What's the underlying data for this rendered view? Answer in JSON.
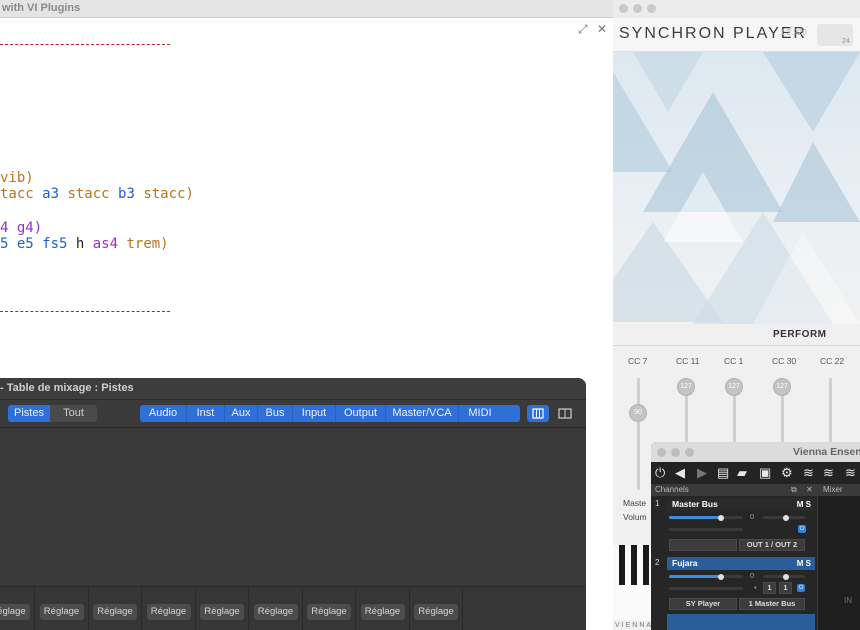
{
  "editor": {
    "title": "with VI Plugins",
    "code_lines": [
      {
        "parts": [
          {
            "t": "vib)",
            "c": "#b7741b"
          }
        ]
      },
      {
        "parts": [
          {
            "t": "tacc ",
            "c": "#b7741b"
          },
          {
            "t": "a3",
            "c": "#1d5fd0"
          },
          {
            "t": " stacc ",
            "c": "#b7741b"
          },
          {
            "t": "b3",
            "c": "#1d5fd0"
          },
          {
            "t": " stacc)",
            "c": "#b7741b"
          }
        ]
      },
      {
        "parts": [
          {
            "t": "4 g4)",
            "c": "#9a2fc4"
          }
        ]
      },
      {
        "parts": [
          {
            "t": "5 ",
            "c": "#1d5fd0"
          },
          {
            "t": "e5 fs5",
            "c": "#1d5fd0"
          },
          {
            "t": " h ",
            "c": "#222222"
          },
          {
            "t": "as4",
            "c": "#9a2fc4"
          },
          {
            "t": " trem)",
            "c": "#b7741b"
          }
        ]
      }
    ],
    "window_icons": [
      "expand-icon",
      "close-icon"
    ]
  },
  "mixer": {
    "title": "- Table de mixage : Pistes",
    "view_tabs": [
      {
        "label": "Pistes",
        "active": true
      },
      {
        "label": "Tout",
        "active": false
      }
    ],
    "filters": [
      "Audio",
      "Inst",
      "Aux",
      "Bus",
      "Input",
      "Output",
      "Master/VCA",
      "MIDI"
    ],
    "reglage_label": "Réglage",
    "reglage_count": 9
  },
  "synchron": {
    "brand": "SYNCHRON PLAYER",
    "version": "1.2.220",
    "corner_number": "24",
    "section": "PERFORM",
    "controls": [
      {
        "label": "CC 7",
        "value": "90"
      },
      {
        "label": "CC 11",
        "value": "127"
      },
      {
        "label": "CC 1",
        "value": "127"
      },
      {
        "label": "CC 30",
        "value": "127"
      },
      {
        "label": "CC 22",
        "value": ""
      }
    ],
    "master_label_1": "Maste",
    "master_label_2": "Volum",
    "footer": "VIENNA"
  },
  "vep": {
    "title": "Vienna Ensen",
    "channels_label": "Channels",
    "mixer_label": "Mixer",
    "in_label": "IN",
    "channels": [
      {
        "num": "1",
        "name": "Master Bus",
        "ms": "M S",
        "zero": "0",
        "output": "OUT 1 / OUT 2"
      },
      {
        "num": "2",
        "name": "Fujara",
        "ms": "M S",
        "zero": "0",
        "midi_a": "1",
        "midi_b": "1",
        "plugin": "SY Player",
        "routing": "1 Master Bus"
      }
    ],
    "accent_color": "#2f7fd6"
  }
}
